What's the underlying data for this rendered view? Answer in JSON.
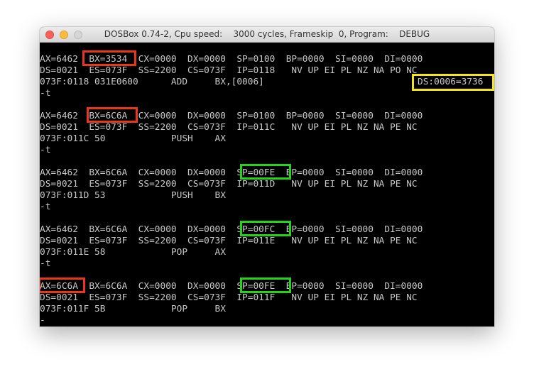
{
  "window": {
    "title": "DOSBox 0.74-2, Cpu speed:    3000 cycles, Frameskip  0, Program:    DEBUG"
  },
  "colors": {
    "terminal_background": "#000000",
    "terminal_text": "#c8c8c8",
    "highlight_red": "#e8361f",
    "highlight_green": "#27d21f",
    "highlight_yellow": "#f2e51a"
  },
  "terminal": {
    "lines": [
      "AX=6462  BX=3534  CX=0000  DX=0000  SP=0100  BP=0000  SI=0000  DI=0000",
      "DS=0021  ES=073F  SS=2200  CS=073F  IP=0118   NV UP EI PL NZ NA PO NC",
      "073F:0118 031E0600      ADD     BX,[0006]",
      "-t",
      "",
      "AX=6462  BX=6C6A  CX=0000  DX=0000  SP=0100  BP=0000  SI=0000  DI=0000",
      "DS=0021  ES=073F  SS=2200  CS=073F  IP=011C   NV UP EI PL NZ NA PE NC",
      "073F:011C 50            PUSH    AX",
      "-t",
      "",
      "AX=6462  BX=6C6A  CX=0000  DX=0000  SP=00FE  BP=0000  SI=0000  DI=0000",
      "DS=0021  ES=073F  SS=2200  CS=073F  IP=011D   NV UP EI PL NZ NA PE NC",
      "073F:011D 53            PUSH    BX",
      "-t",
      "",
      "AX=6462  BX=6C6A  CX=0000  DX=0000  SP=00FC  BP=0000  SI=0000  DI=0000",
      "DS=0021  ES=073F  SS=2200  CS=073F  IP=011E   NV UP EI PL NZ NA PE NC",
      "073F:011E 58            POP     AX",
      "-t",
      "",
      "AX=6C6A  BX=6C6A  CX=0000  DX=0000  SP=00FE  BP=0000  SI=0000  DI=0000",
      "DS=0021  ES=073F  SS=2200  CS=073F  IP=011F   NV UP EI PL NZ NA PE NC",
      "073F:011F 5B            POP     BX",
      "-"
    ],
    "memory_annotation": "DS:0006=3736"
  }
}
